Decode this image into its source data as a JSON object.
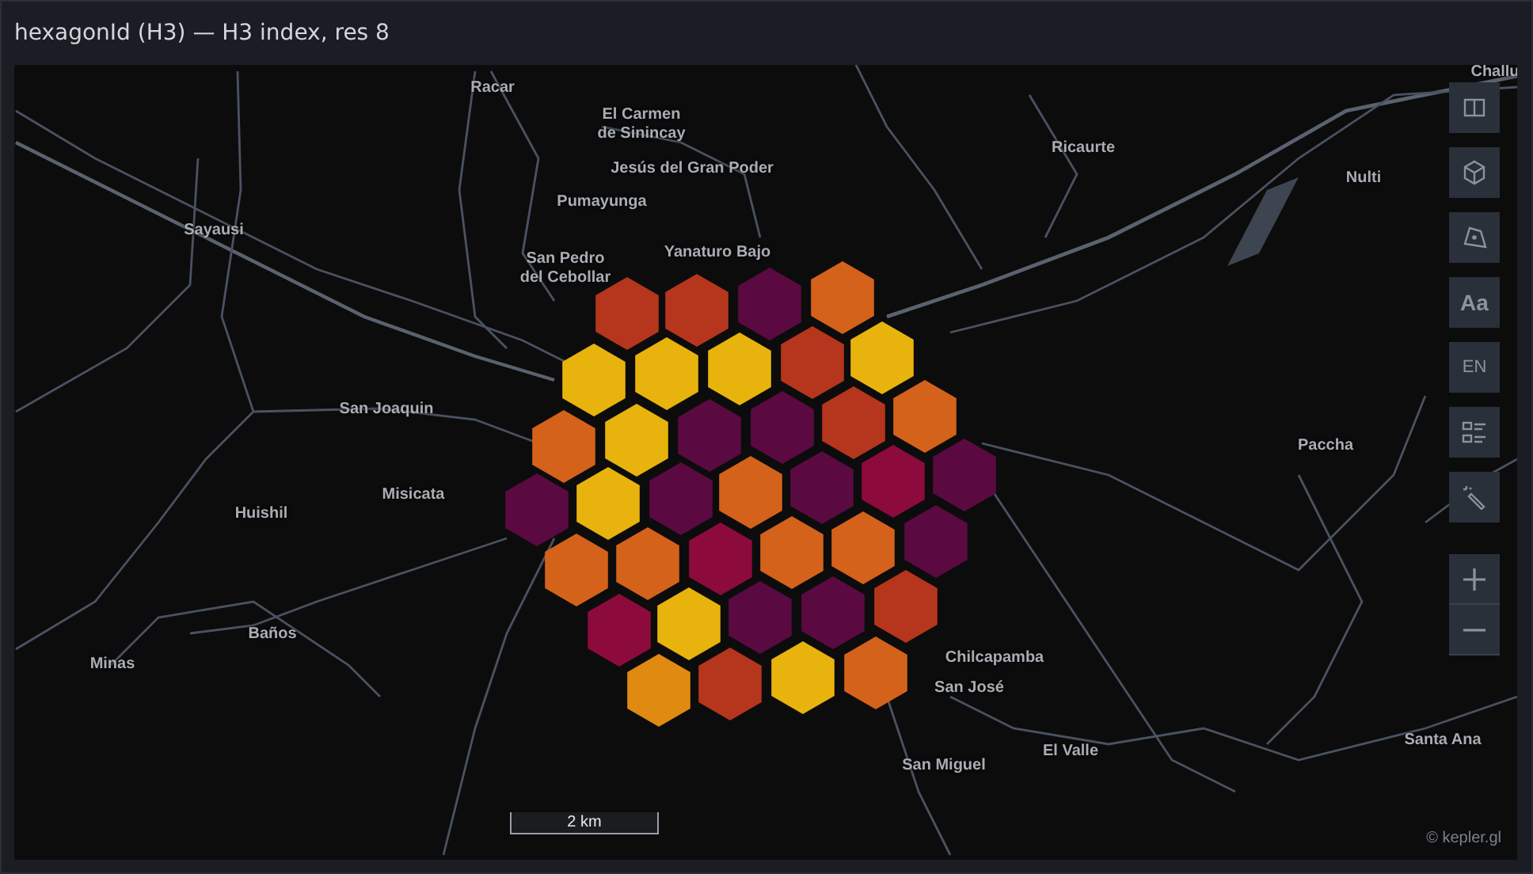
{
  "panel": {
    "title": "hexagonId (H3) — H3 index, res 8"
  },
  "map": {
    "places": [
      {
        "lines": [
          "Racar"
        ]
      },
      {
        "lines": [
          "El Carmen",
          "de Sinincay"
        ]
      },
      {
        "lines": [
          "Jesús del Gran Poder"
        ]
      },
      {
        "lines": [
          "Pumayunga"
        ]
      },
      {
        "lines": [
          "Sayausi"
        ]
      },
      {
        "lines": [
          "San Pedro",
          "del Cebollar"
        ]
      },
      {
        "lines": [
          "Yanaturo Bajo"
        ]
      },
      {
        "lines": [
          "Ricaurte"
        ]
      },
      {
        "lines": [
          "Nulti"
        ]
      },
      {
        "lines": [
          "Challu"
        ]
      },
      {
        "lines": [
          "San Joaquin"
        ]
      },
      {
        "lines": [
          "Paccha"
        ]
      },
      {
        "lines": [
          "Huishil"
        ]
      },
      {
        "lines": [
          "Misicata"
        ]
      },
      {
        "lines": [
          "Baños"
        ]
      },
      {
        "lines": [
          "Minas"
        ]
      },
      {
        "lines": [
          "Chilcapamba"
        ]
      },
      {
        "lines": [
          "San José"
        ]
      },
      {
        "lines": [
          "San Miguel"
        ]
      },
      {
        "lines": [
          "El Valle"
        ]
      },
      {
        "lines": [
          "Santa Ana"
        ]
      }
    ],
    "hexagons": [
      {
        "color": "#b5361c"
      },
      {
        "color": "#b5361c"
      },
      {
        "color": "#5a0a40"
      },
      {
        "color": "#d4621a"
      },
      {
        "color": "#e8b30c"
      },
      {
        "color": "#e8b30c"
      },
      {
        "color": "#e8b30c"
      },
      {
        "color": "#b5361c"
      },
      {
        "color": "#e8b30c"
      },
      {
        "color": "#d4621a"
      },
      {
        "color": "#e8b30c"
      },
      {
        "color": "#5a0a40"
      },
      {
        "color": "#5a0a40"
      },
      {
        "color": "#b5361c"
      },
      {
        "color": "#d4621a"
      },
      {
        "color": "#5a0a40"
      },
      {
        "color": "#e8b30c"
      },
      {
        "color": "#5a0a40"
      },
      {
        "color": "#d4621a"
      },
      {
        "color": "#5a0a40"
      },
      {
        "color": "#8c0a3c"
      },
      {
        "color": "#5a0a40"
      },
      {
        "color": "#d4621a"
      },
      {
        "color": "#d4621a"
      },
      {
        "color": "#8c0a3c"
      },
      {
        "color": "#d4621a"
      },
      {
        "color": "#d4621a"
      },
      {
        "color": "#5a0a40"
      },
      {
        "color": "#8c0a3c"
      },
      {
        "color": "#e8b30c"
      },
      {
        "color": "#5a0a40"
      },
      {
        "color": "#5a0a40"
      },
      {
        "color": "#b5361c"
      },
      {
        "color": "#e08a12"
      },
      {
        "color": "#b5361c"
      },
      {
        "color": "#e8b30c"
      },
      {
        "color": "#d4621a"
      }
    ],
    "controls": [
      {
        "kind": "split"
      },
      {
        "kind": "cube"
      },
      {
        "kind": "draw"
      },
      {
        "kind": "text",
        "label": "Aa"
      },
      {
        "kind": "text",
        "label": "EN"
      },
      {
        "kind": "legend"
      },
      {
        "kind": "wand"
      }
    ],
    "zoom": [
      {
        "kind": "plus"
      },
      {
        "kind": "minus"
      }
    ],
    "scale": "2 km",
    "attribution": "© kepler.gl"
  }
}
